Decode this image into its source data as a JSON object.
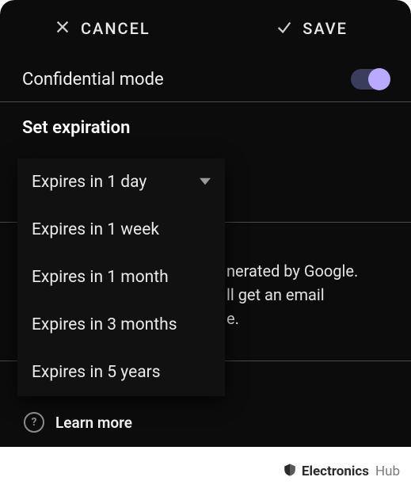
{
  "header": {
    "cancel_label": "CANCEL",
    "save_label": "SAVE"
  },
  "confidential": {
    "label": "Confidential mode",
    "enabled": true
  },
  "expiration": {
    "title": "Set expiration",
    "selected": "Expires in 1 day",
    "options": [
      "Expires in 1 day",
      "Expires in 1 week",
      "Expires in 1 month",
      "Expires in 3 months",
      "Expires in 5 years"
    ]
  },
  "passcode_hint": {
    "visible_fragments": {
      "line1_right": "nerated by Google.",
      "line2_right": "ll get an email",
      "line3_right": "e."
    }
  },
  "learn_more": "Learn more",
  "watermark": {
    "brand": "Electronics",
    "suffix": "Hub"
  },
  "colors": {
    "accent": "#b9a9ff",
    "bg": "#0c0c0c"
  }
}
